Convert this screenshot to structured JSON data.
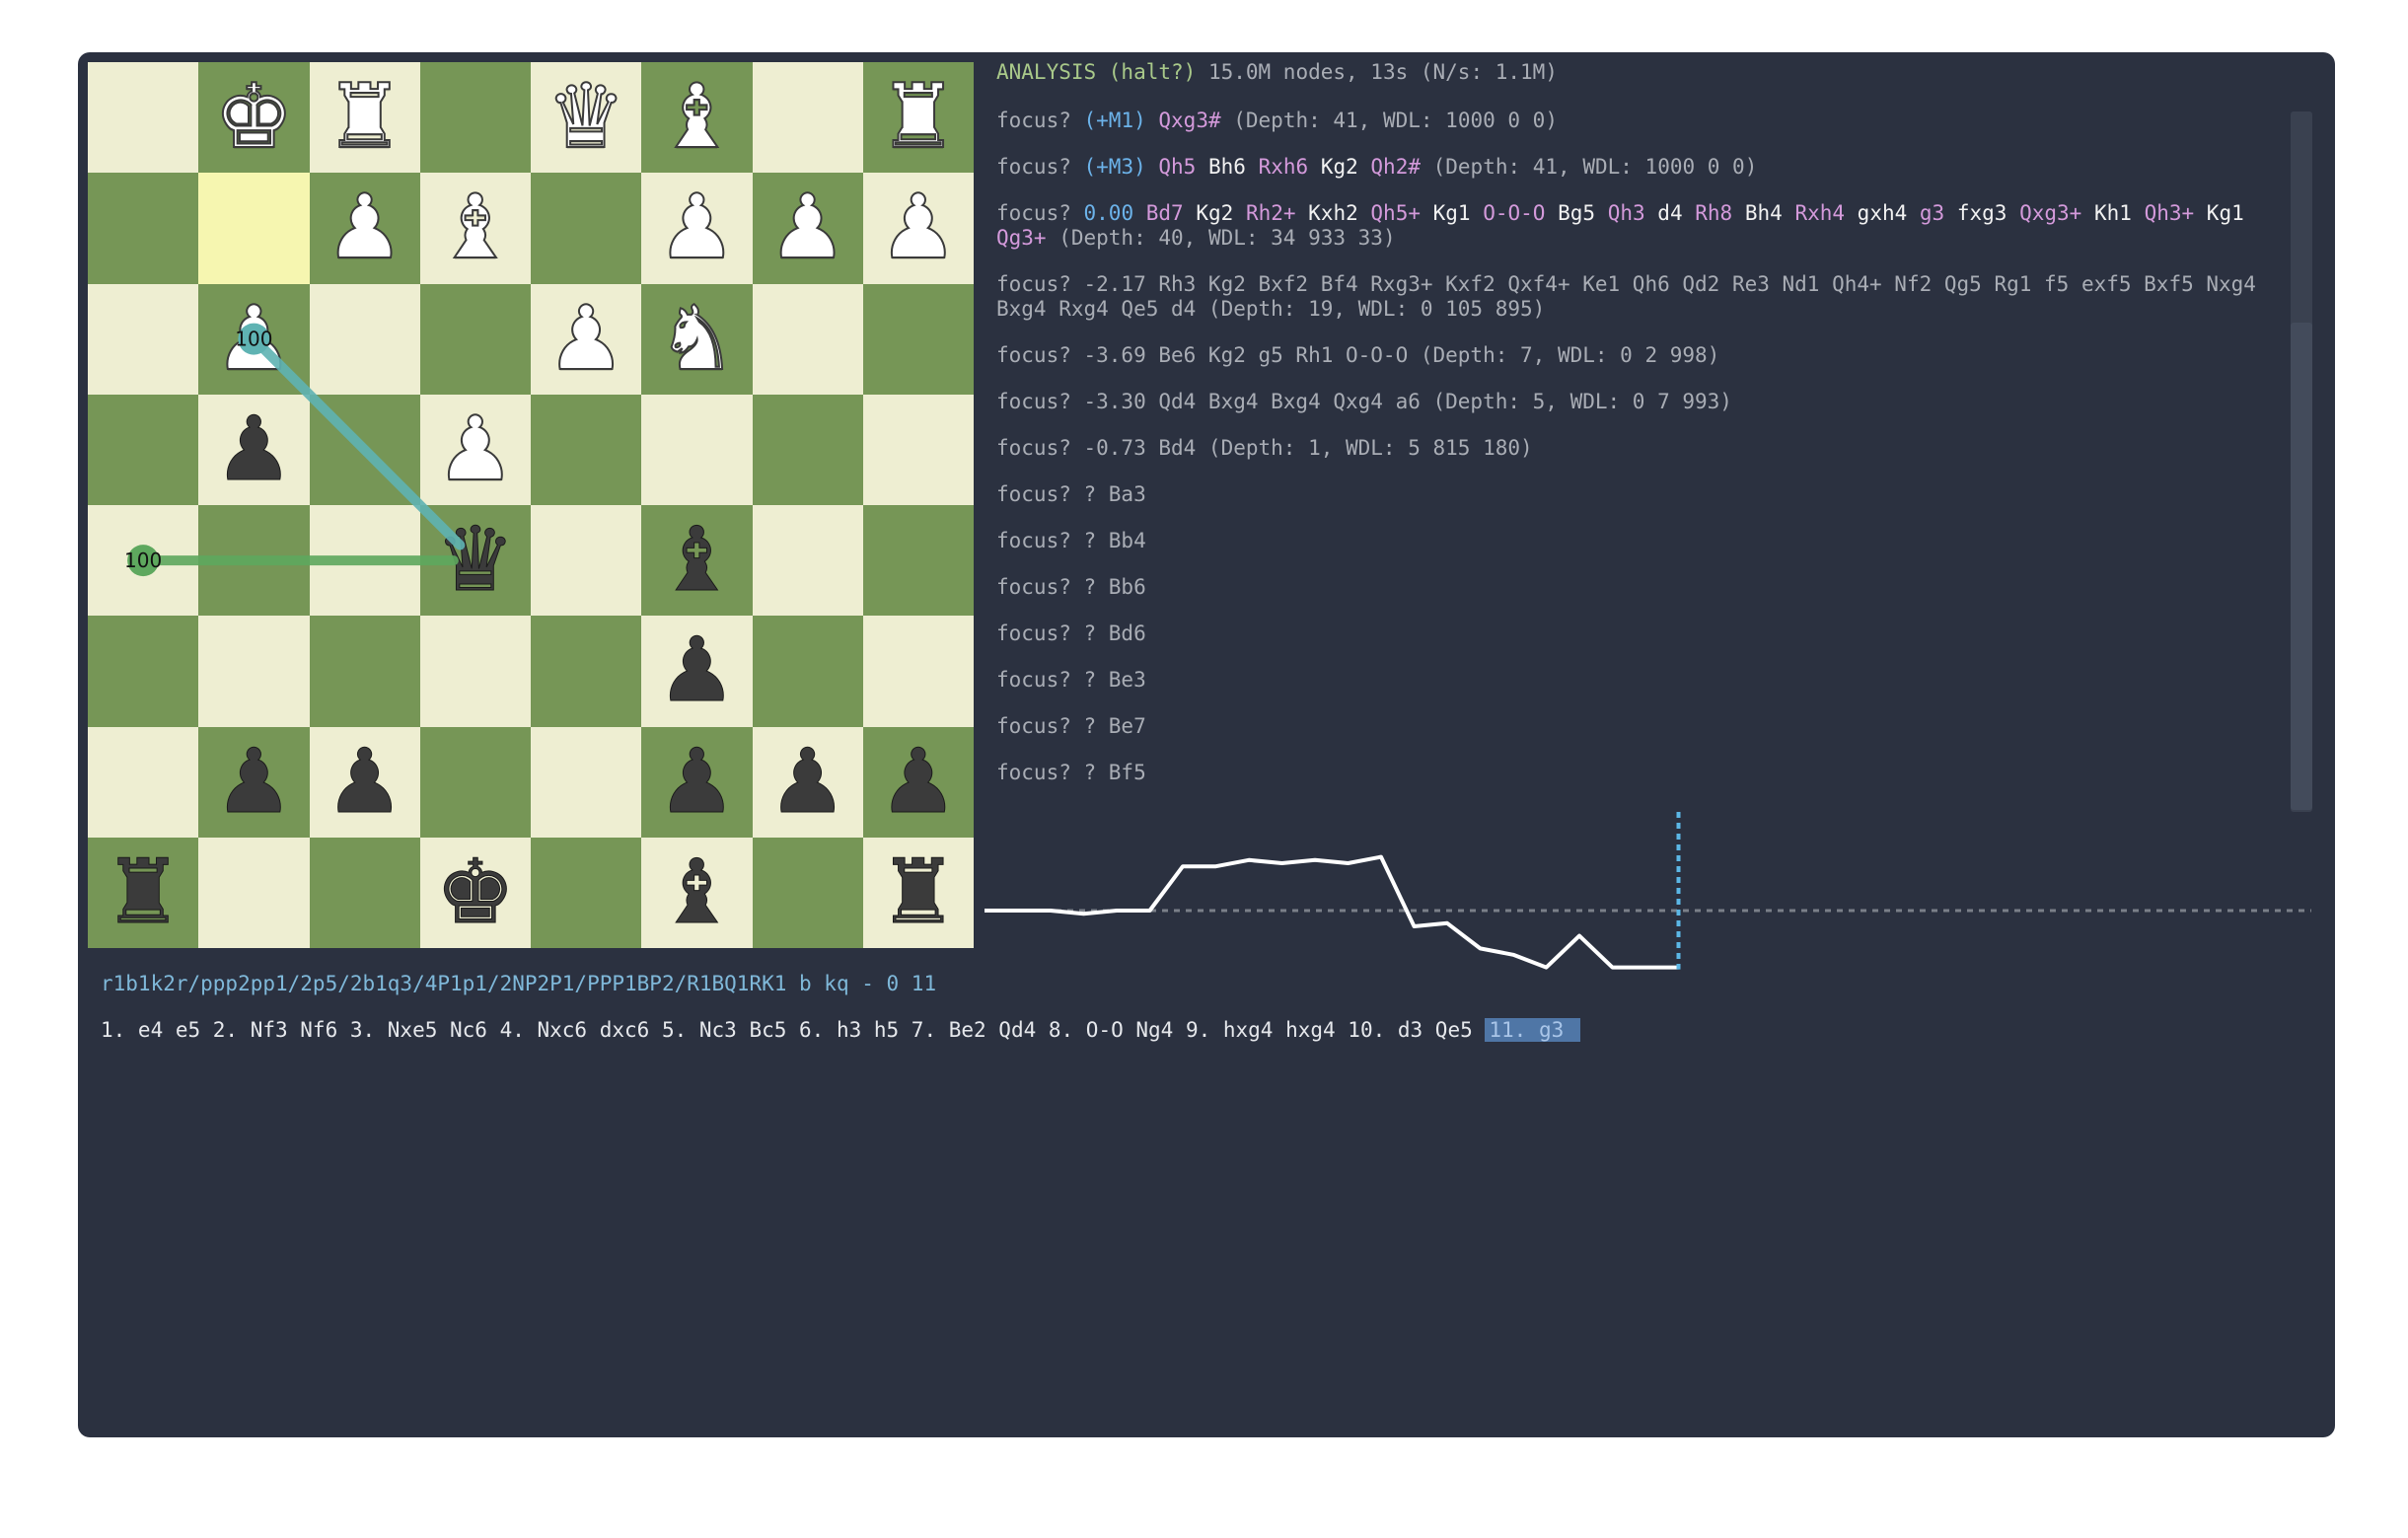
{
  "board": {
    "highlight_squares": [
      "b7"
    ],
    "ranks": [
      [
        {
          "sq": "a8",
          "color": "light",
          "piece": null
        },
        {
          "sq": "b8",
          "color": "dark",
          "piece": {
            "side": "w",
            "glyph": "♚",
            "name": "white-king"
          }
        },
        {
          "sq": "c8",
          "color": "light",
          "piece": {
            "side": "w",
            "glyph": "♜",
            "name": "white-rook"
          }
        },
        {
          "sq": "d8",
          "color": "dark",
          "piece": null
        },
        {
          "sq": "e8",
          "color": "light",
          "piece": {
            "side": "w",
            "glyph": "♛",
            "name": "white-queen"
          }
        },
        {
          "sq": "f8",
          "color": "dark",
          "piece": {
            "side": "w",
            "glyph": "♝",
            "name": "white-bishop"
          }
        },
        {
          "sq": "g8",
          "color": "light",
          "piece": null
        },
        {
          "sq": "h8",
          "color": "dark",
          "piece": {
            "side": "w",
            "glyph": "♜",
            "name": "white-rook"
          }
        }
      ],
      [
        {
          "sq": "a7",
          "color": "dark",
          "piece": null
        },
        {
          "sq": "b7",
          "color": "light",
          "piece": null
        },
        {
          "sq": "c7",
          "color": "dark",
          "piece": {
            "side": "w",
            "glyph": "♟",
            "name": "white-pawn"
          }
        },
        {
          "sq": "d7",
          "color": "light",
          "piece": {
            "side": "w",
            "glyph": "♝",
            "name": "white-bishop"
          }
        },
        {
          "sq": "e7",
          "color": "dark",
          "piece": null
        },
        {
          "sq": "f7",
          "color": "light",
          "piece": {
            "side": "w",
            "glyph": "♟",
            "name": "white-pawn"
          }
        },
        {
          "sq": "g7",
          "color": "dark",
          "piece": {
            "side": "w",
            "glyph": "♟",
            "name": "white-pawn"
          }
        },
        {
          "sq": "h7",
          "color": "light",
          "piece": {
            "side": "w",
            "glyph": "♟",
            "name": "white-pawn"
          }
        }
      ],
      [
        {
          "sq": "a6",
          "color": "light",
          "piece": null
        },
        {
          "sq": "b6",
          "color": "dark",
          "piece": {
            "side": "w",
            "glyph": "♟",
            "name": "white-pawn"
          }
        },
        {
          "sq": "c6",
          "color": "light",
          "piece": null
        },
        {
          "sq": "d6",
          "color": "dark",
          "piece": null
        },
        {
          "sq": "e6",
          "color": "light",
          "piece": {
            "side": "w",
            "glyph": "♟",
            "name": "white-pawn"
          }
        },
        {
          "sq": "f6",
          "color": "dark",
          "piece": {
            "side": "w",
            "glyph": "♞",
            "name": "white-knight"
          }
        },
        {
          "sq": "g6",
          "color": "light",
          "piece": null
        },
        {
          "sq": "h6",
          "color": "dark",
          "piece": null
        }
      ],
      [
        {
          "sq": "a5",
          "color": "dark",
          "piece": null
        },
        {
          "sq": "b5",
          "color": "light",
          "piece": {
            "side": "b",
            "glyph": "♟",
            "name": "black-pawn"
          }
        },
        {
          "sq": "c5",
          "color": "dark",
          "piece": null
        },
        {
          "sq": "d5",
          "color": "light",
          "piece": {
            "side": "w",
            "glyph": "♟",
            "name": "white-pawn"
          }
        },
        {
          "sq": "e5",
          "color": "dark",
          "piece": null
        },
        {
          "sq": "f5",
          "color": "light",
          "piece": null
        },
        {
          "sq": "g5",
          "color": "dark",
          "piece": null
        },
        {
          "sq": "h5",
          "color": "light",
          "piece": null
        }
      ],
      [
        {
          "sq": "a4",
          "color": "light",
          "piece": null
        },
        {
          "sq": "b4",
          "color": "dark",
          "piece": null
        },
        {
          "sq": "c4",
          "color": "light",
          "piece": null
        },
        {
          "sq": "d4",
          "color": "dark",
          "piece": {
            "side": "b",
            "glyph": "♛",
            "name": "black-queen"
          }
        },
        {
          "sq": "e4",
          "color": "light",
          "piece": null
        },
        {
          "sq": "f4",
          "color": "dark",
          "piece": {
            "side": "b",
            "glyph": "♝",
            "name": "black-bishop"
          }
        },
        {
          "sq": "g4",
          "color": "light",
          "piece": null
        },
        {
          "sq": "h4",
          "color": "dark",
          "piece": null
        }
      ],
      [
        {
          "sq": "a3",
          "color": "dark",
          "piece": null
        },
        {
          "sq": "b3",
          "color": "light",
          "piece": null
        },
        {
          "sq": "c3",
          "color": "dark",
          "piece": null
        },
        {
          "sq": "d3",
          "color": "light",
          "piece": null
        },
        {
          "sq": "e3",
          "color": "dark",
          "piece": null
        },
        {
          "sq": "f3",
          "color": "light",
          "piece": {
            "side": "b",
            "glyph": "♟",
            "name": "black-pawn"
          }
        },
        {
          "sq": "g3",
          "color": "dark",
          "piece": null
        },
        {
          "sq": "h3",
          "color": "light",
          "piece": null
        }
      ],
      [
        {
          "sq": "a2",
          "color": "light",
          "piece": null
        },
        {
          "sq": "b2",
          "color": "dark",
          "piece": {
            "side": "b",
            "glyph": "♟",
            "name": "black-pawn"
          }
        },
        {
          "sq": "c2",
          "color": "light",
          "piece": {
            "side": "b",
            "glyph": "♟",
            "name": "black-pawn"
          }
        },
        {
          "sq": "d2",
          "color": "dark",
          "piece": null
        },
        {
          "sq": "e2",
          "color": "light",
          "piece": null
        },
        {
          "sq": "f2",
          "color": "dark",
          "piece": {
            "side": "b",
            "glyph": "♟",
            "name": "black-pawn"
          }
        },
        {
          "sq": "g2",
          "color": "light",
          "piece": {
            "side": "b",
            "glyph": "♟",
            "name": "black-pawn"
          }
        },
        {
          "sq": "h2",
          "color": "dark",
          "piece": {
            "side": "b",
            "glyph": "♟",
            "name": "black-pawn"
          }
        }
      ],
      [
        {
          "sq": "a1",
          "color": "dark",
          "piece": {
            "side": "b",
            "glyph": "♜",
            "name": "black-rook"
          }
        },
        {
          "sq": "b1",
          "color": "light",
          "piece": null
        },
        {
          "sq": "c1",
          "color": "dark",
          "piece": null
        },
        {
          "sq": "d1",
          "color": "light",
          "piece": {
            "side": "b",
            "glyph": "♚",
            "name": "black-king"
          }
        },
        {
          "sq": "e1",
          "color": "dark",
          "piece": null
        },
        {
          "sq": "f1",
          "color": "light",
          "piece": {
            "side": "b",
            "glyph": "♝",
            "name": "black-bishop"
          }
        },
        {
          "sq": "g1",
          "color": "dark",
          "piece": null
        },
        {
          "sq": "h1",
          "color": "light",
          "piece": {
            "side": "b",
            "glyph": "♜",
            "name": "black-rook"
          }
        }
      ]
    ],
    "arrows": [
      {
        "from": "b6",
        "to": "d4",
        "color": "#5fb3b3",
        "label": "100"
      },
      {
        "from": "a4",
        "to": "d4",
        "color": "#5ea85e",
        "label": "100"
      }
    ]
  },
  "analysis": {
    "header": [
      {
        "t": "ANALYSIS (halt?)",
        "c": "c-green"
      },
      {
        "t": " 15.0M nodes, 13s (N/s: 1.1M)",
        "c": "c-gray"
      }
    ],
    "lines": [
      [
        {
          "t": "focus? ",
          "c": "c-gray"
        },
        {
          "t": "(+M1)",
          "c": "c-blue"
        },
        {
          "t": " ",
          "c": "c-gray"
        },
        {
          "t": "Qxg3#",
          "c": "c-pink"
        },
        {
          "t": " (Depth: 41, WDL: 1000 0 0)",
          "c": "c-gray"
        }
      ],
      [
        {
          "t": "focus? ",
          "c": "c-gray"
        },
        {
          "t": "(+M3)",
          "c": "c-blue"
        },
        {
          "t": " ",
          "c": "c-gray"
        },
        {
          "t": "Qh5",
          "c": "c-pink"
        },
        {
          "t": " ",
          "c": "c-gray"
        },
        {
          "t": "Bh6",
          "c": "c-white"
        },
        {
          "t": " ",
          "c": "c-gray"
        },
        {
          "t": "Rxh6",
          "c": "c-pink"
        },
        {
          "t": " ",
          "c": "c-gray"
        },
        {
          "t": "Kg2",
          "c": "c-white"
        },
        {
          "t": " ",
          "c": "c-gray"
        },
        {
          "t": "Qh2#",
          "c": "c-pink"
        },
        {
          "t": " (Depth: 41, WDL: 1000 0 0)",
          "c": "c-gray"
        }
      ],
      [
        {
          "t": "focus? ",
          "c": "c-gray"
        },
        {
          "t": "0.00",
          "c": "c-blue"
        },
        {
          "t": " ",
          "c": "c-gray"
        },
        {
          "t": "Bd7",
          "c": "c-pink"
        },
        {
          "t": " ",
          "c": "c-gray"
        },
        {
          "t": "Kg2",
          "c": "c-white"
        },
        {
          "t": " ",
          "c": "c-gray"
        },
        {
          "t": "Rh2+",
          "c": "c-pink"
        },
        {
          "t": " ",
          "c": "c-gray"
        },
        {
          "t": "Kxh2",
          "c": "c-white"
        },
        {
          "t": " ",
          "c": "c-gray"
        },
        {
          "t": "Qh5+",
          "c": "c-pink"
        },
        {
          "t": " ",
          "c": "c-gray"
        },
        {
          "t": "Kg1",
          "c": "c-white"
        },
        {
          "t": " ",
          "c": "c-gray"
        },
        {
          "t": "O-O-O",
          "c": "c-pink"
        },
        {
          "t": " ",
          "c": "c-gray"
        },
        {
          "t": "Bg5",
          "c": "c-white"
        },
        {
          "t": " ",
          "c": "c-gray"
        },
        {
          "t": "Qh3",
          "c": "c-pink"
        },
        {
          "t": " ",
          "c": "c-gray"
        },
        {
          "t": "d4",
          "c": "c-white"
        },
        {
          "t": " ",
          "c": "c-gray"
        },
        {
          "t": "Rh8",
          "c": "c-pink"
        },
        {
          "t": " ",
          "c": "c-gray"
        },
        {
          "t": "Bh4",
          "c": "c-white"
        },
        {
          "t": " ",
          "c": "c-gray"
        },
        {
          "t": "Rxh4",
          "c": "c-pink"
        },
        {
          "t": " ",
          "c": "c-gray"
        },
        {
          "t": "gxh4",
          "c": "c-white"
        },
        {
          "t": " ",
          "c": "c-gray"
        },
        {
          "t": "g3",
          "c": "c-pink"
        },
        {
          "t": " ",
          "c": "c-gray"
        },
        {
          "t": "fxg3",
          "c": "c-white"
        },
        {
          "t": " ",
          "c": "c-gray"
        },
        {
          "t": "Qxg3+",
          "c": "c-pink"
        },
        {
          "t": " ",
          "c": "c-gray"
        },
        {
          "t": "Kh1",
          "c": "c-white"
        },
        {
          "t": " ",
          "c": "c-gray"
        },
        {
          "t": "Qh3+",
          "c": "c-pink"
        },
        {
          "t": " ",
          "c": "c-gray"
        },
        {
          "t": "Kg1",
          "c": "c-white"
        },
        {
          "t": " ",
          "c": "c-gray"
        },
        {
          "t": "Qg3+",
          "c": "c-pink"
        },
        {
          "t": " (Depth: 40, WDL: 34 933 33)",
          "c": "c-gray"
        }
      ],
      [
        {
          "t": "focus? -2.17 Rh3 Kg2 Bxf2 Bf4 Rxg3+ Kxf2 Qxf4+ Ke1 Qh6 Qd2 Re3 Nd1 Qh4+ Nf2 Qg5 Rg1 f5 exf5 Bxf5 Nxg4 Bxg4 Rxg4 Qe5 d4 (Depth: 19, WDL: 0 105 895)",
          "c": "c-gray"
        }
      ],
      [
        {
          "t": "focus? -3.69 Be6 Kg2 g5 Rh1 O-O-O (Depth: 7, WDL: 0 2 998)",
          "c": "c-gray"
        }
      ],
      [
        {
          "t": "focus? -3.30 Qd4 Bxg4 Bxg4 Qxg4 a6 (Depth: 5, WDL: 0 7 993)",
          "c": "c-gray"
        }
      ],
      [
        {
          "t": "focus? -0.73 Bd4 (Depth: 1, WDL: 5 815 180)",
          "c": "c-gray"
        }
      ],
      [
        {
          "t": "focus? ? Ba3",
          "c": "c-gray"
        }
      ],
      [
        {
          "t": "focus? ? Bb4",
          "c": "c-gray"
        }
      ],
      [
        {
          "t": "focus? ? Bb6",
          "c": "c-gray"
        }
      ],
      [
        {
          "t": "focus? ? Bd6",
          "c": "c-gray"
        }
      ],
      [
        {
          "t": "focus? ? Be3",
          "c": "c-gray"
        }
      ],
      [
        {
          "t": "focus? ? Be7",
          "c": "c-gray"
        }
      ],
      [
        {
          "t": "focus? ? Bf5",
          "c": "c-gray"
        }
      ]
    ]
  },
  "eval_graph": {
    "values": [
      0.0,
      0.0,
      0.0,
      -0.1,
      0.0,
      0.0,
      1.4,
      1.4,
      1.6,
      1.5,
      1.6,
      1.5,
      1.7,
      -0.5,
      -0.4,
      -1.2,
      -1.4,
      -1.8,
      -0.8,
      -1.8,
      -1.8,
      -1.8
    ],
    "ylim": [
      -2.5,
      2.5
    ],
    "current_index": 21,
    "line_color": "#ffffff",
    "zero_line_color": "#7a7f88",
    "marker_color": "#5bb7e6"
  },
  "fen": "r1b1k2r/ppp2pp1/2p5/2b1q3/4P1p1/2NP2P1/PPP1BP2/R1BQ1RK1 b kq - 0 11",
  "moves": {
    "played": "1. e4 e5 2. Nf3 Nf6 3. Nxe5 Nc6 4. Nxc6 dxc6 5. Nc3 Bc5 6. h3 h5 7. Be2 Qd4 8. O-O Ng4 9. hxg4 hxg4 10. d3 Qe5 ",
    "current": "11. g3 "
  }
}
